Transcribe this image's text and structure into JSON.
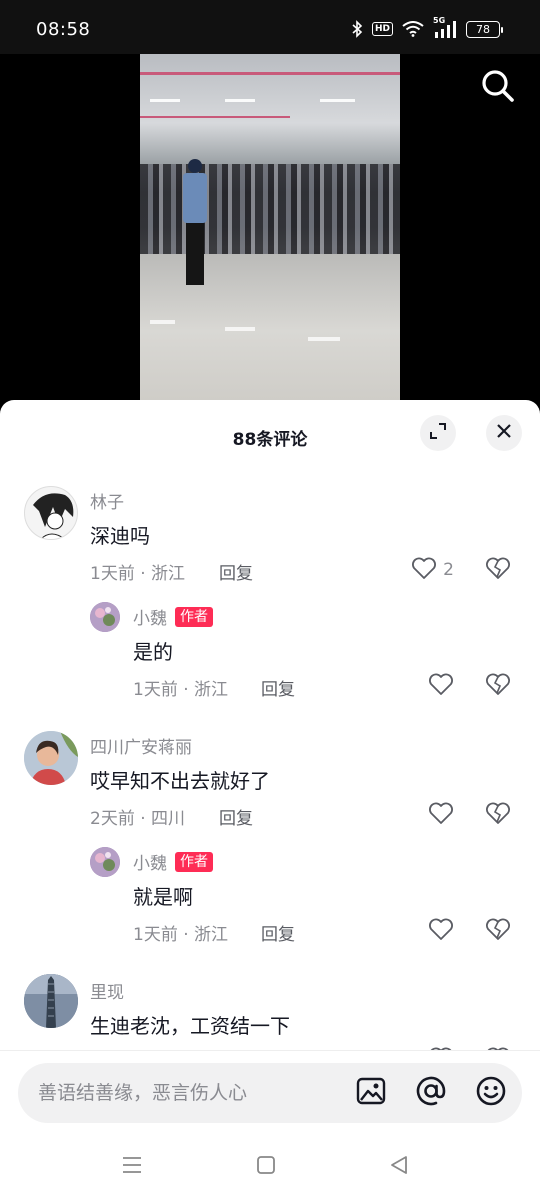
{
  "status_bar": {
    "time": "08:58",
    "hd_label": "HD",
    "network_label": "5G",
    "battery": "78",
    "icons": [
      "bluetooth-icon",
      "hd-icon",
      "wifi-icon",
      "signal-5g-icon",
      "battery-icon"
    ]
  },
  "video": {
    "search_icon": "search-icon"
  },
  "sheet": {
    "title": "88条评论",
    "expand_icon": "expand-icon",
    "close_icon": "close-icon"
  },
  "comments": [
    {
      "name": "林子",
      "text": "深迪吗",
      "meta": "1天前 · 浙江",
      "reply": "回复",
      "likes": "2"
    },
    {
      "name": "小魏",
      "badge": "作者",
      "text": "是的",
      "meta": "1天前 · 浙江",
      "reply": "回复",
      "likes": ""
    },
    {
      "name": "四川广安蒋丽",
      "text": "哎早知不出去就好了",
      "meta": "2天前 · 四川",
      "reply": "回复",
      "likes": ""
    },
    {
      "name": "小魏",
      "badge": "作者",
      "text": "就是啊",
      "meta": "1天前 · 浙江",
      "reply": "回复",
      "likes": ""
    },
    {
      "name": "里现",
      "text": "生迪老沈，工资结一下",
      "meta": "",
      "reply": "",
      "likes": ""
    }
  ],
  "input": {
    "placeholder": "善语结善缘，恶言伤人心",
    "icons": [
      "image-icon",
      "at-icon",
      "emoji-icon"
    ]
  },
  "navbar": {
    "icons": [
      "menu-icon",
      "home-icon",
      "back-icon"
    ]
  },
  "colors": {
    "accent": "#fe2c55",
    "text_primary": "#161823",
    "text_secondary": "#8a8b91"
  }
}
